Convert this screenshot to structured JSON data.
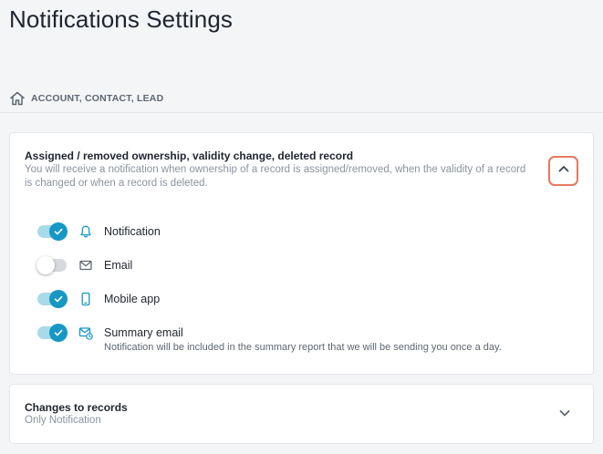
{
  "page": {
    "title": "Notifications Settings"
  },
  "breadcrumb": {
    "text": "ACCOUNT, CONTACT, LEAD"
  },
  "sections": [
    {
      "title": "Assigned / removed ownership, validity change, deleted record",
      "description": "You will receive a notification when ownership of a record is assigned/removed, when the validity of a record is changed or when a record is deleted.",
      "expanded": true,
      "options": [
        {
          "label": "Notification",
          "icon": "bell-icon",
          "enabled": true,
          "note": ""
        },
        {
          "label": "Email",
          "icon": "envelope-icon",
          "enabled": false,
          "note": ""
        },
        {
          "label": "Mobile app",
          "icon": "mobile-phone-icon",
          "enabled": true,
          "note": ""
        },
        {
          "label": "Summary email",
          "icon": "summary-email-icon",
          "enabled": true,
          "note": "Notification will be included in the summary report that we will be sending you once a day."
        }
      ]
    },
    {
      "title": "Changes to records",
      "subtitle": "Only Notification",
      "expanded": false
    }
  ],
  "colors": {
    "accent": "#1697c4",
    "toggle_track_on": "#a8dbe9",
    "toggle_track_off": "#d6d9de",
    "focus_outline": "#e8785c"
  }
}
